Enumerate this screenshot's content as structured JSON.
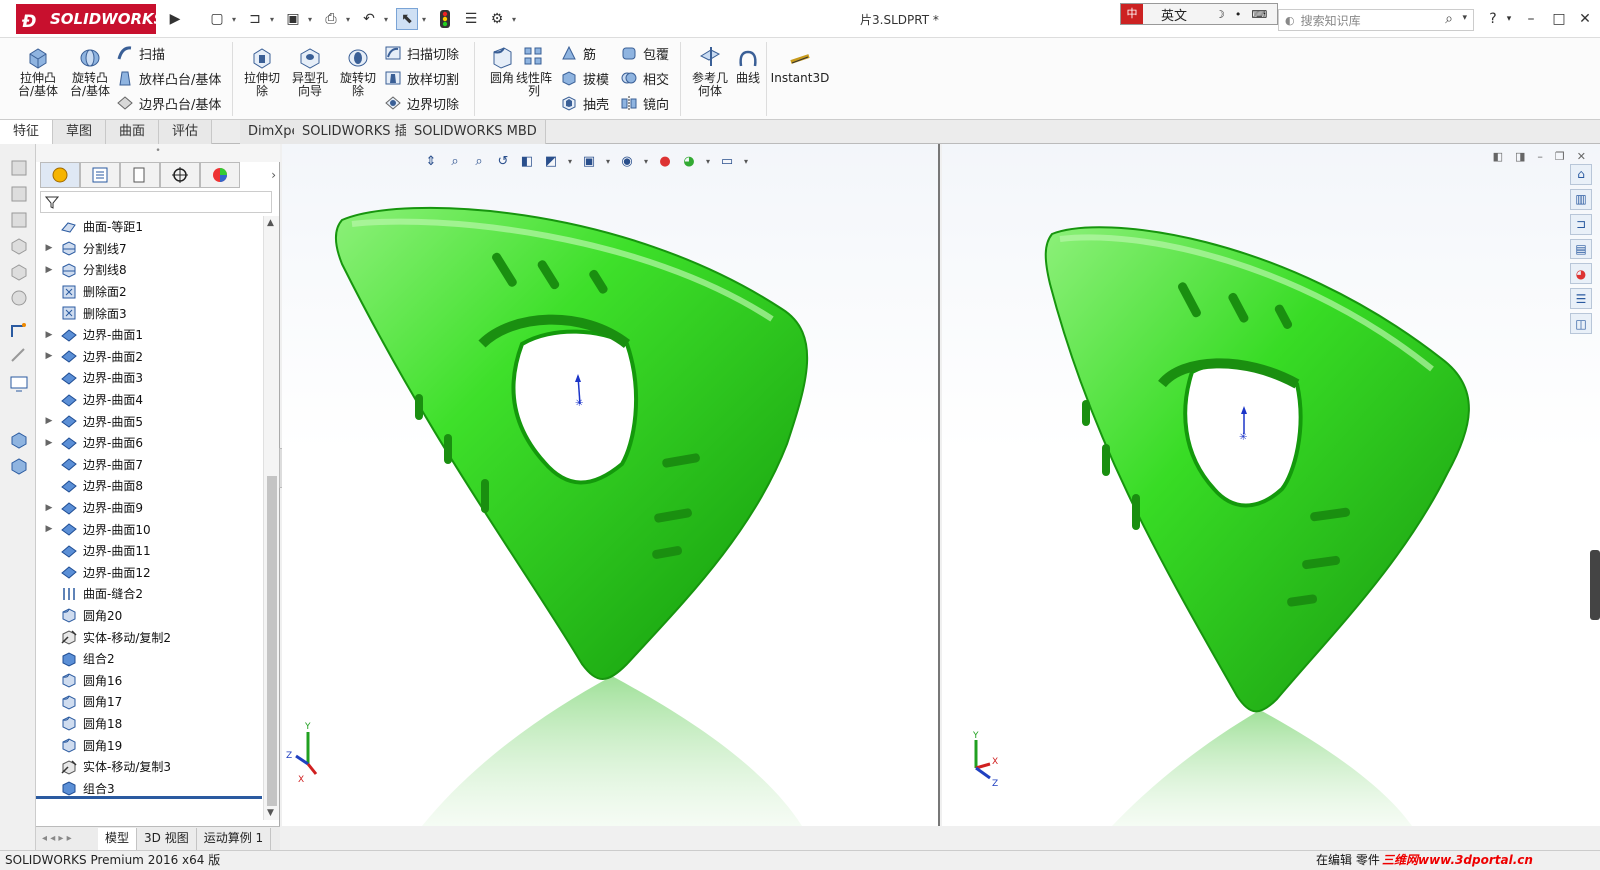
{
  "app": {
    "brand": "SOLIDWORKS",
    "document_title": "片3.SLDPRT *"
  },
  "titlebar": {
    "language_label": "英文",
    "search_placeholder": "搜索知识库",
    "help": "?"
  },
  "ribbon": {
    "extrude_boss": "拉伸凸台/基体",
    "revolve_boss": "旋转凸台/基体",
    "sweep": "扫描",
    "loft_boss": "放样凸台/基体",
    "boundary_boss": "边界凸台/基体",
    "extrude_cut": "拉伸切除",
    "hole_wizard": "异型孔向导",
    "revolve_cut": "旋转切除",
    "sweep_cut": "扫描切除",
    "loft_cut": "放样切割",
    "boundary_cut": "边界切除",
    "fillet": "圆角",
    "linear_pattern": "线性阵列",
    "rib": "筋",
    "draft": "拔模",
    "shell": "抽壳",
    "wrap": "包覆",
    "intersect": "相交",
    "mirror": "镜向",
    "reference_geometry": "参考几何体",
    "curves": "曲线",
    "instant3d": "Instant3D"
  },
  "command_tabs": [
    "特征",
    "草图",
    "曲面",
    "评估",
    "DimXpert",
    "SOLIDWORKS 插件",
    "SOLIDWORKS MBD"
  ],
  "feature_tree": {
    "items": [
      {
        "label": "曲面-等距1",
        "expandable": false,
        "icon": "surface-offset-icon"
      },
      {
        "label": "分割线7",
        "expandable": true,
        "icon": "split-line-icon"
      },
      {
        "label": "分割线8",
        "expandable": true,
        "icon": "split-line-icon"
      },
      {
        "label": "删除面2",
        "expandable": false,
        "icon": "delete-face-icon"
      },
      {
        "label": "删除面3",
        "expandable": false,
        "icon": "delete-face-icon"
      },
      {
        "label": "边界-曲面1",
        "expandable": true,
        "icon": "boundary-surface-icon"
      },
      {
        "label": "边界-曲面2",
        "expandable": true,
        "icon": "boundary-surface-icon"
      },
      {
        "label": "边界-曲面3",
        "expandable": false,
        "icon": "boundary-surface-icon"
      },
      {
        "label": "边界-曲面4",
        "expandable": false,
        "icon": "boundary-surface-icon"
      },
      {
        "label": "边界-曲面5",
        "expandable": true,
        "icon": "boundary-surface-icon"
      },
      {
        "label": "边界-曲面6",
        "expandable": true,
        "icon": "boundary-surface-icon"
      },
      {
        "label": "边界-曲面7",
        "expandable": false,
        "icon": "boundary-surface-icon"
      },
      {
        "label": "边界-曲面8",
        "expandable": false,
        "icon": "boundary-surface-icon"
      },
      {
        "label": "边界-曲面9",
        "expandable": true,
        "icon": "boundary-surface-icon"
      },
      {
        "label": "边界-曲面10",
        "expandable": true,
        "icon": "boundary-surface-icon"
      },
      {
        "label": "边界-曲面11",
        "expandable": false,
        "icon": "boundary-surface-icon"
      },
      {
        "label": "边界-曲面12",
        "expandable": false,
        "icon": "boundary-surface-icon"
      },
      {
        "label": "曲面-缝合2",
        "expandable": false,
        "icon": "knit-surface-icon"
      },
      {
        "label": "圆角20",
        "expandable": false,
        "icon": "fillet-icon"
      },
      {
        "label": "实体-移动/复制2",
        "expandable": false,
        "icon": "move-copy-icon"
      },
      {
        "label": "组合2",
        "expandable": false,
        "icon": "combine-icon"
      },
      {
        "label": "圆角16",
        "expandable": false,
        "icon": "fillet-icon"
      },
      {
        "label": "圆角17",
        "expandable": false,
        "icon": "fillet-icon"
      },
      {
        "label": "圆角18",
        "expandable": false,
        "icon": "fillet-icon"
      },
      {
        "label": "圆角19",
        "expandable": false,
        "icon": "fillet-icon"
      },
      {
        "label": "实体-移动/复制3",
        "expandable": false,
        "icon": "move-copy-icon"
      },
      {
        "label": "组合3",
        "expandable": false,
        "icon": "combine-icon"
      }
    ]
  },
  "bottom_tabs": [
    "模型",
    "3D 视图",
    "运动算例 1"
  ],
  "status": {
    "left": "SOLIDWORKS Premium 2016 x64 版",
    "editing": "在编辑 零件",
    "watermark": "三维网www.3dportal.cn"
  },
  "triad": {
    "x": "X",
    "y": "Y",
    "z": "Z"
  },
  "colors": {
    "model_green": "#33dd22",
    "brand_red": "#c8102e",
    "axis_x": "#d02020",
    "axis_y": "#20a020",
    "axis_z": "#2040c0"
  }
}
